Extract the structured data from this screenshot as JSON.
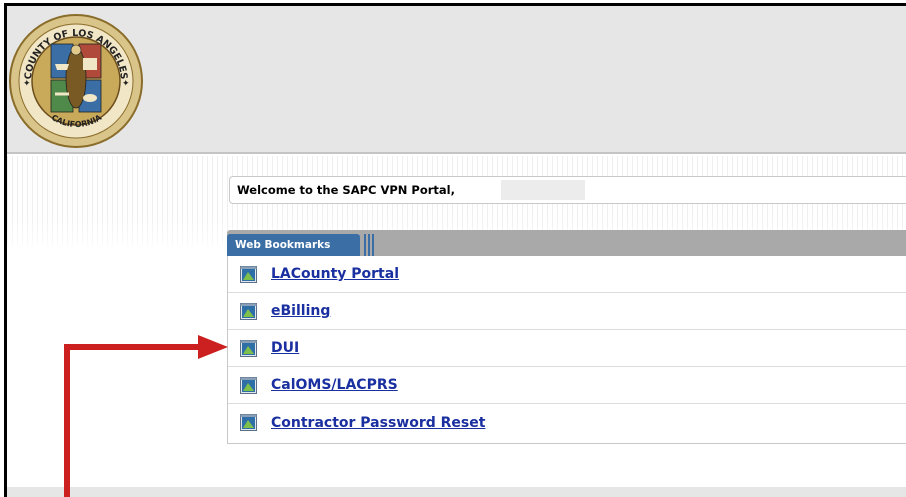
{
  "header": {
    "seal": {
      "top_text": "COUNTY OF LOS ANGELES",
      "bottom_text": "CALIFORNIA"
    }
  },
  "welcome": {
    "text": "Welcome to the SAPC VPN Portal,"
  },
  "bookmarks": {
    "tab_label": "Web Bookmarks",
    "items": [
      {
        "label": "LACounty Portal",
        "icon": "web-bookmark-icon"
      },
      {
        "label": "eBilling",
        "icon": "web-bookmark-icon"
      },
      {
        "label": "DUI",
        "icon": "web-bookmark-icon"
      },
      {
        "label": "CalOMS/LACPRS",
        "icon": "web-bookmark-icon"
      },
      {
        "label": "Contractor Password Reset",
        "icon": "web-bookmark-icon"
      }
    ]
  },
  "annotation": {
    "color": "#cc1f1f",
    "points_to": "DUI"
  },
  "colors": {
    "link": "#1a2fa0",
    "tab": "#3a6ea5",
    "header_bg": "#e6e6e6"
  }
}
